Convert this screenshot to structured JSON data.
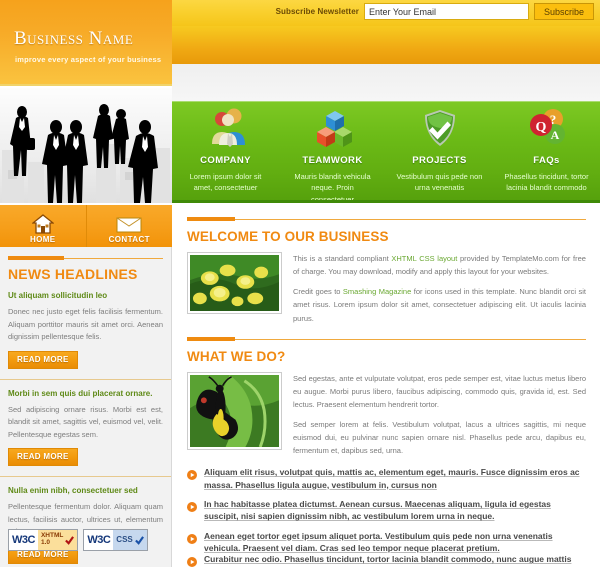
{
  "topbar": {
    "newsletter_label": "Subscribe Newsletter",
    "email_value": "Enter Your Email",
    "email_placeholder": "Enter Your Email",
    "subscribe_label": "Subscribe"
  },
  "logo": {
    "title": "Business Name",
    "tagline": "improve every aspect of your business"
  },
  "features": [
    {
      "icon": "people-icon",
      "title": "COMPANY",
      "desc": "Lorem ipsum dolor sit amet, consectetuer"
    },
    {
      "icon": "blocks-icon",
      "title": "TEAMWORK",
      "desc": "Mauris blandit vehicula neque. Proin consectetuer"
    },
    {
      "icon": "shield-check-icon",
      "title": "PROJECTS",
      "desc": "Vestibulum quis pede non urna venenatis"
    },
    {
      "icon": "qa-circles-icon",
      "title": "FAQs",
      "desc": "Phasellus tincidunt, tortor lacinia blandit commodo"
    }
  ],
  "nav": [
    {
      "icon": "home-icon",
      "label": "HOME"
    },
    {
      "icon": "envelope-icon",
      "label": "CONTACT"
    }
  ],
  "sidebar": {
    "heading": "NEWS HEADLINES",
    "read_more_label": "READ MORE",
    "news": [
      {
        "title": "Ut aliquam sollicitudin leo",
        "body": "Donec nec justo eget felis facilisis fermentum. Aliquam porttitor mauris sit amet orci. Aenean dignissim pellentesque felis."
      },
      {
        "title": "Morbi in sem quis dui placerat ornare.",
        "body": "Sed adipiscing ornare risus. Morbi est est, blandit sit amet, sagittis vel, euismod vel, velit. Pellentesque egestas sem."
      },
      {
        "title": "Nulla enim nibh, consectetuer sed",
        "body": "Pellentesque fermentum dolor. Aliquam quam lectus, facilisis auctor, ultrices ut, elementum vulputate, nunc."
      }
    ],
    "badges": [
      {
        "name": "w3c-xhtml-badge",
        "org": "W3C",
        "kind": "XHTML",
        "version": "1.0"
      },
      {
        "name": "w3c-css-badge",
        "org": "W3C",
        "kind": "CSS",
        "version": ""
      }
    ]
  },
  "main": {
    "welcome": {
      "heading": "WELCOME TO OUR BUSINESS",
      "image": "yellow-flowers-photo",
      "p1_a": "This is a standard compliant ",
      "p1_link1": "XHTML",
      "p1_b": " ",
      "p1_link2": "CSS layout",
      "p1_c": " provided by TemplateMo.com for free of charge. You may download, modify and apply this layout for your websites.",
      "p2_a": "Credit goes to ",
      "p2_link": "Smashing Magazine",
      "p2_b": " for icons used in this template. Nunc blandit orci sit amet risus. Lorem ipsum dolor sit amet, consectetuer adipiscing elit. Ut iaculis lacinia purus."
    },
    "whatwedo": {
      "heading": "WHAT WE DO?",
      "image": "butterfly-photo",
      "p1": "Sed egestas, ante et vulputate volutpat, eros pede semper est, vitae luctus metus libero eu augue. Morbi purus libero, faucibus adipiscing, commodo quis, gravida id, est. Sed lectus. Praesent elementum hendrerit tortor.",
      "p2": "Sed semper lorem at felis. Vestibulum volutpat, lacus a ultrices sagittis, mi neque euismod dui, eu pulvinar nunc sapien ornare nisl. Phasellus pede arcu, dapibus eu, fermentum et, dapibus sed, urna.",
      "bullets": [
        "Aliquam elit risus, volutpat quis, mattis ac, elementum eget, mauris. Fusce dignissim eros ac massa. Phasellus ligula augue, vestibulum in, cursus non",
        "In hac habitasse platea dictumst. Aenean cursus. Maecenas aliquam, ligula id egestas suscipit, nisi sapien dignissim nibh, ac vestibulum lorem urna in neque.",
        "Aenean eget tortor eget ipsum aliquet porta. Vestibulum quis pede non urna venenatis vehicula. Praesent vel diam. Cras sed leo tempor neque placerat pretium.",
        "Curabitur nec odio. Phasellus tincidunt, tortor lacinia blandit commodo, nunc augue mattis"
      ]
    }
  },
  "colors": {
    "orange": "#f08a12",
    "yellow": "#f9cf2c",
    "green": "#6cbb17",
    "green_dark": "#3f8a07",
    "link_green": "#6aa832",
    "sidebar_bg": "#f2f2f2"
  }
}
